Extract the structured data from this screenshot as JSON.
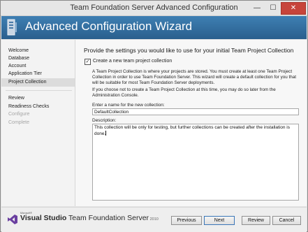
{
  "window": {
    "title": "Team Foundation Server Advanced Configuration",
    "minimize_glyph": "—",
    "maximize_glyph": "☐",
    "close_glyph": "✕"
  },
  "header": {
    "title": "Advanced Configuration Wizard",
    "logo_icon": "tfs-server-icon"
  },
  "sidebar": {
    "items": [
      {
        "label": "Welcome",
        "state": "normal"
      },
      {
        "label": "Database",
        "state": "normal"
      },
      {
        "label": "Account",
        "state": "normal"
      },
      {
        "label": "Application Tier",
        "state": "normal"
      },
      {
        "label": "Project Collection",
        "state": "selected"
      },
      {
        "label": "Review",
        "state": "normal"
      },
      {
        "label": "Readiness Checks",
        "state": "normal"
      },
      {
        "label": "Configure",
        "state": "disabled"
      },
      {
        "label": "Complete",
        "state": "disabled"
      }
    ]
  },
  "main": {
    "heading": "Provide the settings you would like to use for your initial Team Project Collection",
    "create_checkbox": {
      "checked": true,
      "label": "Create a new team project collection"
    },
    "paragraph1": "A Team Project Collection is where your projects are stored. You must create at least one Team Project Collection in order to use Team Foundation Server. This wizard will create a default collection for you that will be suitable for most Team Foundation Server deployments.",
    "paragraph2": "If you choose not to create a Team Project Collection at this time, you may do so later from the Administration Console.",
    "name_label": "Enter a name for the new collection:",
    "name_value": "DefaultCollection",
    "description_label": "Description:",
    "description_value": "This collection will be only for testing, but further collections can be created after the installation is done."
  },
  "footer": {
    "brand_microsoft": "Microsoft®",
    "brand_vs": "Visual Studio",
    "brand_rest": " Team Foundation Server",
    "brand_year": " 2010",
    "buttons": {
      "previous": "Previous",
      "next": "Next",
      "review": "Review",
      "cancel": "Cancel"
    }
  },
  "colors": {
    "header_blue": "#2d6c9e",
    "close_red": "#c7443b"
  }
}
